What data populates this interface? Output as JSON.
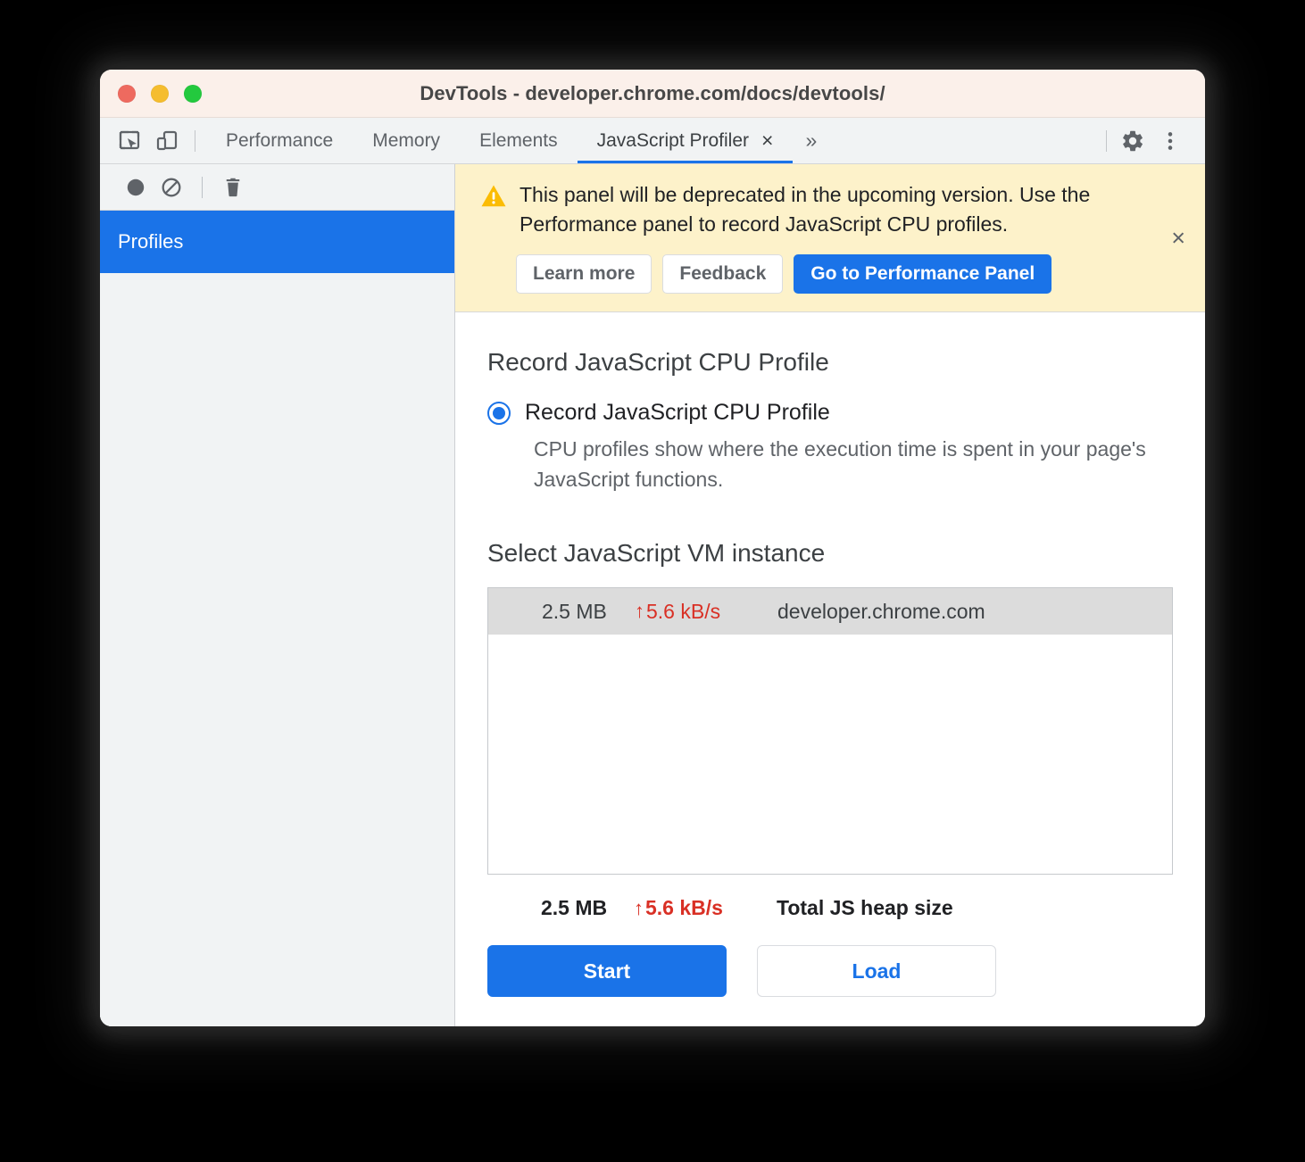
{
  "window": {
    "title": "DevTools - developer.chrome.com/docs/devtools/",
    "traffic_lights": {
      "close_label": "close",
      "minimize_label": "minimize",
      "maximize_label": "maximize",
      "close_color": "#ee6a5f",
      "minimize_color": "#f5bd2f",
      "maximize_color": "#23c93e"
    }
  },
  "tabbar": {
    "inspect_icon": "inspect-element-icon",
    "device_icon": "device-toolbar-icon",
    "tabs": [
      {
        "label": "Performance",
        "active": false
      },
      {
        "label": "Memory",
        "active": false
      },
      {
        "label": "Elements",
        "active": false
      },
      {
        "label": "JavaScript Profiler",
        "active": true
      }
    ],
    "active_tab_close": "×",
    "more_tabs": "»",
    "settings_icon": "gear-icon",
    "menu_icon": "kebab-menu-icon"
  },
  "sidebar": {
    "toolbar": {
      "record_icon": "record-circle-icon",
      "clear_icon": "no-entry-icon",
      "trash_icon": "trash-icon"
    },
    "items": [
      {
        "label": "Profiles",
        "selected": true
      }
    ]
  },
  "banner": {
    "icon": "warning-triangle-icon",
    "message": "This panel will be deprecated in the upcoming version. Use the Performance panel to record JavaScript CPU profiles.",
    "buttons": [
      {
        "label": "Learn more",
        "style": "plain"
      },
      {
        "label": "Feedback",
        "style": "plain"
      },
      {
        "label": "Go to Performance Panel",
        "style": "primary"
      }
    ],
    "close_label": "×",
    "background": "#fdf2ca",
    "primary_color": "#1a73e8"
  },
  "launch": {
    "section_title": "Record JavaScript CPU Profile",
    "radio": {
      "label": "Record JavaScript CPU Profile",
      "checked": true,
      "description": "CPU profiles show where the execution time is spent in your page's JavaScript functions."
    },
    "vm_section_title": "Select JavaScript VM instance",
    "vm_rows": [
      {
        "size": "2.5 MB",
        "rate": "5.6 kB/s",
        "rate_arrow": "↑",
        "name": "developer.chrome.com",
        "selected": true
      }
    ],
    "totals": {
      "size": "2.5 MB",
      "rate": "5.6 kB/s",
      "rate_arrow": "↑",
      "label": "Total JS heap size"
    },
    "actions": [
      {
        "label": "Start",
        "style": "primary"
      },
      {
        "label": "Load",
        "style": "secondary"
      }
    ],
    "rate_color": "#d93025",
    "accent_color": "#1a73e8"
  }
}
